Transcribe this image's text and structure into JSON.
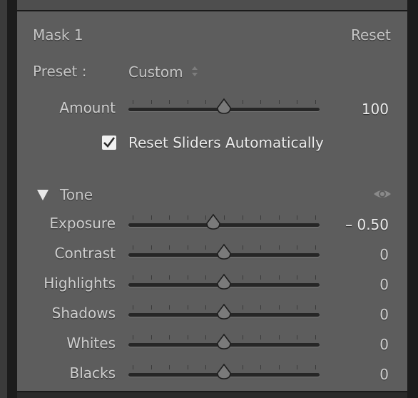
{
  "mask": {
    "title": "Mask 1",
    "reset_label": "Reset",
    "preset_label": "Preset :",
    "preset_value": "Custom",
    "amount_label": "Amount",
    "amount_value": "100",
    "amount_fraction": 0.5,
    "reset_sliders_label": "Reset Sliders Automatically",
    "reset_sliders_checked": true
  },
  "tone": {
    "title": "Tone",
    "sliders": [
      {
        "label": "Exposure",
        "value": "– 0.50",
        "fraction": 0.44
      },
      {
        "label": "Contrast",
        "value": "0",
        "fraction": 0.5
      },
      {
        "label": "Highlights",
        "value": "0",
        "fraction": 0.5
      },
      {
        "label": "Shadows",
        "value": "0",
        "fraction": 0.5
      },
      {
        "label": "Whites",
        "value": "0",
        "fraction": 0.5
      },
      {
        "label": "Blacks",
        "value": "0",
        "fraction": 0.5
      }
    ]
  },
  "icons": {
    "collapse": "triangle-down-icon",
    "visibility": "eye-icon",
    "preset_stepper": "up-down-arrows-icon",
    "checkbox": "checkmark-icon"
  },
  "colors": {
    "panel_bg": "#5d5d5d",
    "text": "#d0d0d0",
    "track": "#262626"
  }
}
